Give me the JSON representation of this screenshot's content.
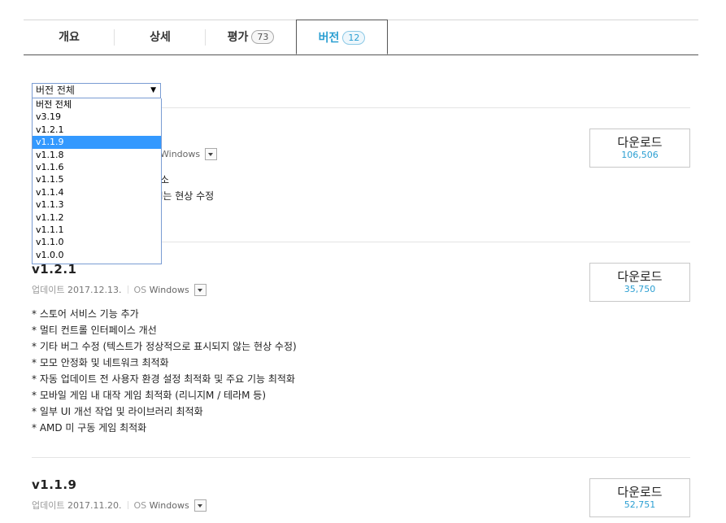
{
  "tabs": [
    {
      "label": "개요",
      "count": null
    },
    {
      "label": "상세",
      "count": null
    },
    {
      "label": "평가",
      "count": "73"
    },
    {
      "label": "버전",
      "count": "12"
    }
  ],
  "version_select": {
    "selected": "버전 전체",
    "options": [
      "버전 전체",
      "v3.19",
      "v1.2.1",
      "v1.1.9",
      "v1.1.8",
      "v1.1.6",
      "v1.1.5",
      "v1.1.4",
      "v1.1.3",
      "v1.1.2",
      "v1.1.1",
      "v1.1.0",
      "v1.0.0"
    ],
    "highlighted": "v1.1.9"
  },
  "releases": [
    {
      "title": "",
      "update_label": "",
      "date": "",
      "os_label": "",
      "os_value": "Windows",
      "visible_note_fragments": [
        "소",
        "l는 현상 수정"
      ],
      "download_label": "다운로드",
      "download_count": "106,506"
    },
    {
      "title": "v1.2.1",
      "update_label": "업데이트",
      "date": "2017.12.13.",
      "os_label": "OS",
      "os_value": "Windows",
      "notes": [
        "* 스토어 서비스 기능 추가",
        "* 멀티 컨트롤 인터페이스 개선",
        "* 기타 버그 수정 (텍스트가 정상적으로 표시되지 않는 현상 수정)",
        "* 모모 안정화 및 네트워크 최적화",
        "* 자동 업데이트 전 사용자 환경 설정 최적화 및 주요 기능 최적화",
        "* 모바일 게임 내 대작 게임 최적화 (리니지M / 테라M 등)",
        "* 일부 UI 개선 작업 및 라이브러리 최적화",
        "* AMD 미 구동 게임 최적화"
      ],
      "download_label": "다운로드",
      "download_count": "35,750"
    },
    {
      "title": "v1.1.9",
      "update_label": "업데이트",
      "date": "2017.11.20.",
      "os_label": "OS",
      "os_value": "Windows",
      "download_label": "다운로드",
      "download_count": "52,751"
    }
  ]
}
